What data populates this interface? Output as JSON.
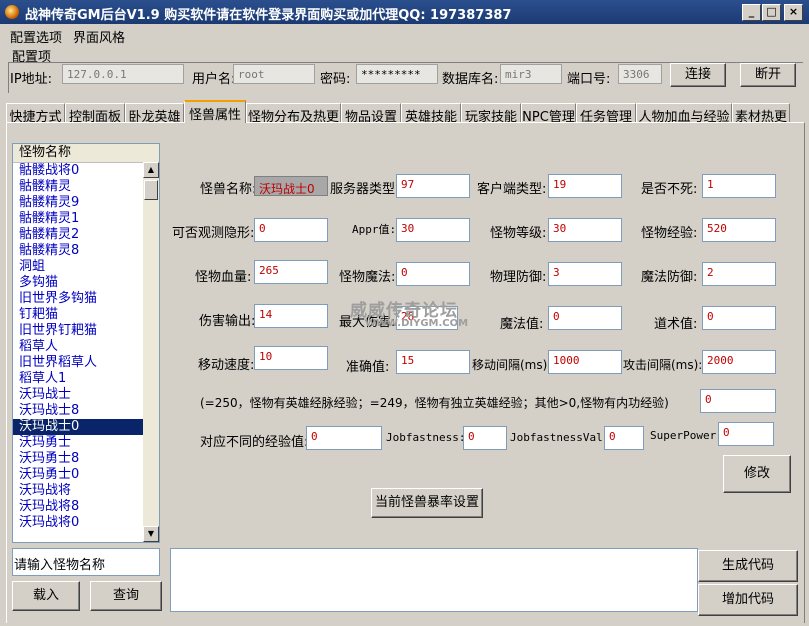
{
  "title": "战神传奇GM后台V1.9    购买软件请在软件登录界面购买或加代理QQ:  197387387",
  "window_buttons": {
    "minimize": "_",
    "maximize": "□",
    "close": "×"
  },
  "menu": [
    "配置选项",
    "界面风格"
  ],
  "config": {
    "group_label": "配置项",
    "ip_label": "IP地址:",
    "ip_value": "127.0.0.1",
    "user_label": "用户名:",
    "user_value": "root",
    "pwd_label": "密码:",
    "pwd_value": "*********",
    "db_label": "数据库名:",
    "db_value": "mir3",
    "port_label": "端口号:",
    "port_value": "3306",
    "connect_label": "连接",
    "disconnect_label": "断开"
  },
  "tabs": [
    "快捷方式",
    "控制面板",
    "卧龙英雄",
    "怪兽属性",
    "怪物分布及热更",
    "物品设置",
    "英雄技能",
    "玩家技能",
    "NPC管理",
    "任务管理",
    "人物加血与经验",
    "素材热更"
  ],
  "active_tab": "怪兽属性",
  "monster_list": {
    "header": "怪物名称",
    "items": [
      "骷髅战将0",
      "骷髅精灵",
      "骷髅精灵9",
      "骷髅精灵1",
      "骷髅精灵2",
      "骷髅精灵8",
      "洞蛆",
      "多钩猫",
      "旧世界多钩猫",
      "钉耙猫",
      "旧世界钉耙猫",
      "稻草人",
      "旧世界稻草人",
      "稻草人1",
      "沃玛战士",
      "沃玛战士8",
      "沃玛战士0",
      "沃玛勇士",
      "沃玛勇士8",
      "沃玛勇士0",
      "沃玛战将",
      "沃玛战将8",
      "沃玛战将0"
    ],
    "selected_index": 16
  },
  "search": {
    "placeholder": "请输入怪物名称",
    "load_label": "载入",
    "query_label": "查询"
  },
  "form": {
    "name_label": "怪兽名称:",
    "name_value": "沃玛战士0",
    "server_type_label": "服务器类型:",
    "server_type_value": "97",
    "client_type_label": "客户端类型:",
    "client_type_value": "19",
    "undead_label": "是否不死:",
    "undead_value": "1",
    "see_invisible_label": "可否观测隐形:",
    "see_invisible_value": "0",
    "appr_label": "Appr值:",
    "appr_value": "30",
    "level_label": "怪物等级:",
    "level_value": "30",
    "exp_label": "怪物经验:",
    "exp_value": "520",
    "hp_label": "怪物血量:",
    "hp_value": "265",
    "mp_label": "怪物魔法:",
    "mp_value": "0",
    "ac_label": "物理防御:",
    "ac_value": "3",
    "mac_label": "魔法防御:",
    "mac_value": "2",
    "dmg_label": "伤害输出:",
    "dmg_value": "14",
    "maxdmg_label": "最大伤害:",
    "maxdmg_value": "28",
    "magic_label": "魔法值:",
    "magic_value": "0",
    "sc_label": "道术值:",
    "sc_value": "0",
    "speed_label": "移动速度:",
    "speed_value": "10",
    "accuracy_label": "准确值:",
    "accuracy_value": "15",
    "move_interval_label": "移动间隔(ms):",
    "move_interval_value": "1000",
    "attack_interval_label": "攻击间隔(ms):",
    "attack_interval_value": "2000",
    "note": "(=250，怪物有英雄经脉经验；=249，怪物有独立英雄经验；其他>0,怪物有内功经验)",
    "note_value": "0",
    "diff_exp_label": "对应不同的经验值:",
    "diff_exp_value": "0",
    "jobfast_label": "Jobfastness:",
    "jobfast_value": "0",
    "jobfastval_label": "JobfastnessVal:",
    "jobfastval_value": "0",
    "superpower_label": "SuperPower:",
    "superpower_value": "0",
    "modify_label": "修改",
    "drop_label": "当前怪兽暴率设置"
  },
  "watermark": {
    "line1": "威威传奇论坛",
    "line2": "WWW.DIYGM.COM"
  },
  "bottom": {
    "generate_label": "生成代码",
    "add_label": "增加代码"
  }
}
